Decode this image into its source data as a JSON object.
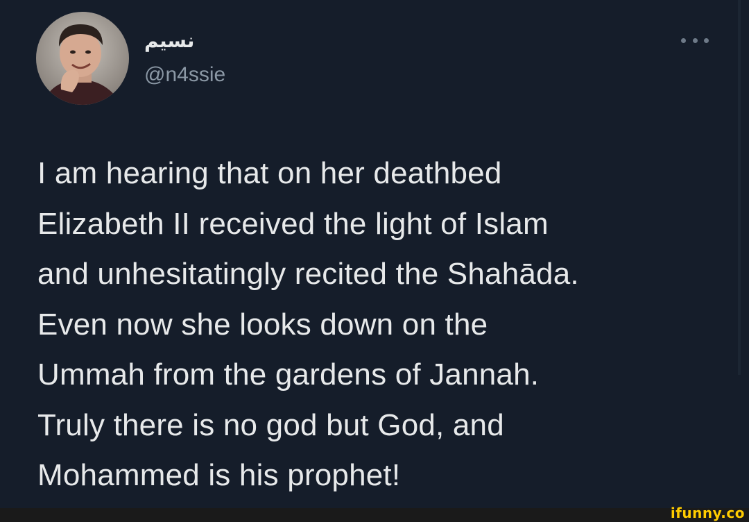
{
  "tweet": {
    "author": {
      "display_name": "نسيم",
      "handle": "@n4ssie"
    },
    "more_icon": "more-horizontal-icon",
    "text": "I am hearing that on her deathbed\nElizabeth II received the light of Islam\nand unhesitatingly recited the Shahāda.\nEven now she looks down on the\nUmmah from the gardens of Jannah.\nTruly there is no god but God, and\nMohammed is his prophet!"
  },
  "watermark": {
    "text": "ifunny.co"
  },
  "colors": {
    "background": "#15202b",
    "text_primary": "#e7e9ea",
    "text_secondary": "#8b98a5",
    "watermark": "#ffcc00"
  }
}
